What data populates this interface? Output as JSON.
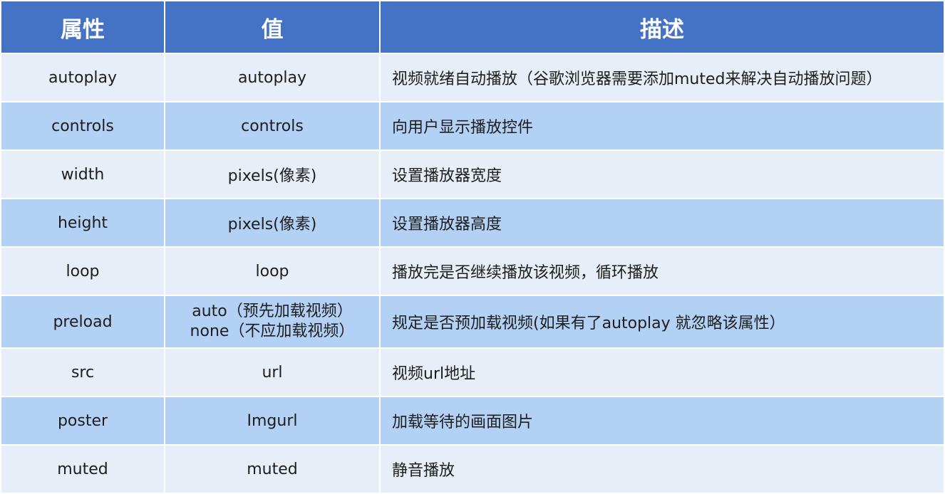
{
  "header": {
    "attribute": "属性",
    "value": "值",
    "description": "描述"
  },
  "rows": [
    {
      "attribute": "autoplay",
      "values": [
        "autoplay"
      ],
      "description": "视频就绪自动播放（谷歌浏览器需要添加muted来解决自动播放问题）"
    },
    {
      "attribute": "controls",
      "values": [
        "controls"
      ],
      "description": "向用户显示播放控件"
    },
    {
      "attribute": "width",
      "values": [
        "pixels(像素)"
      ],
      "description": "设置播放器宽度"
    },
    {
      "attribute": "height",
      "values": [
        "pixels(像素)"
      ],
      "description": "设置播放器高度"
    },
    {
      "attribute": "loop",
      "values": [
        "loop"
      ],
      "description": "播放完是否继续播放该视频，循环播放"
    },
    {
      "attribute": "preload",
      "values": [
        "auto（预先加载视频）",
        "none（不应加载视频）"
      ],
      "description": "规定是否预加载视频(如果有了autoplay 就忽略该属性）"
    },
    {
      "attribute": "src",
      "values": [
        "url"
      ],
      "description": "视频url地址"
    },
    {
      "attribute": "poster",
      "values": [
        "Imgurl"
      ],
      "description": "加载等待的画面图片"
    },
    {
      "attribute": "muted",
      "values": [
        "muted"
      ],
      "description": "静音播放"
    }
  ],
  "colors": {
    "header_bg": "#4472c4",
    "row_light": "#e8eef7",
    "row_blue": "#b3d1f5"
  }
}
